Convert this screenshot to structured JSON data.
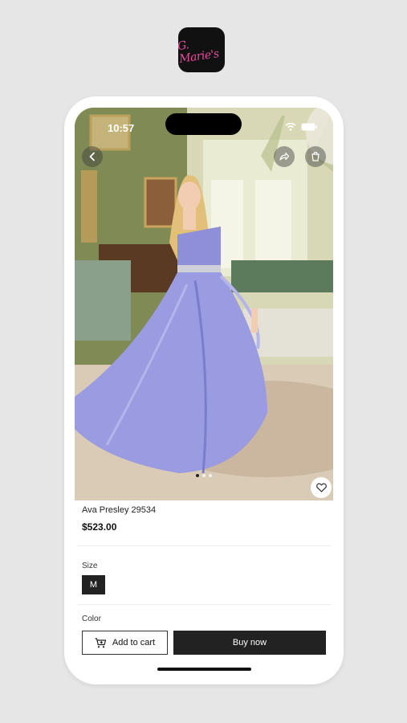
{
  "app_icon": {
    "logo_text": "G. Marie's"
  },
  "status_bar": {
    "time": "10:57"
  },
  "hero": {
    "image_alt": "Woman wearing periwinkle strapless gown in ornate room",
    "pager_count": 3,
    "pager_active": 1
  },
  "product": {
    "name": "Ava Presley 29534",
    "price": "$523.00"
  },
  "size": {
    "label": "Size",
    "options": [
      "M"
    ],
    "selected": "M"
  },
  "color": {
    "label": "Color"
  },
  "actions": {
    "add_to_cart": "Add to cart",
    "buy_now": "Buy now"
  },
  "icons": {
    "back": "chevron-left-icon",
    "share": "share-icon",
    "cart": "cart-icon",
    "favorite": "heart-icon",
    "add_cart": "cart-plus-icon"
  },
  "colors": {
    "accent": "#222222",
    "logo": "#e64fa0",
    "dress": "#8f8fdc"
  }
}
